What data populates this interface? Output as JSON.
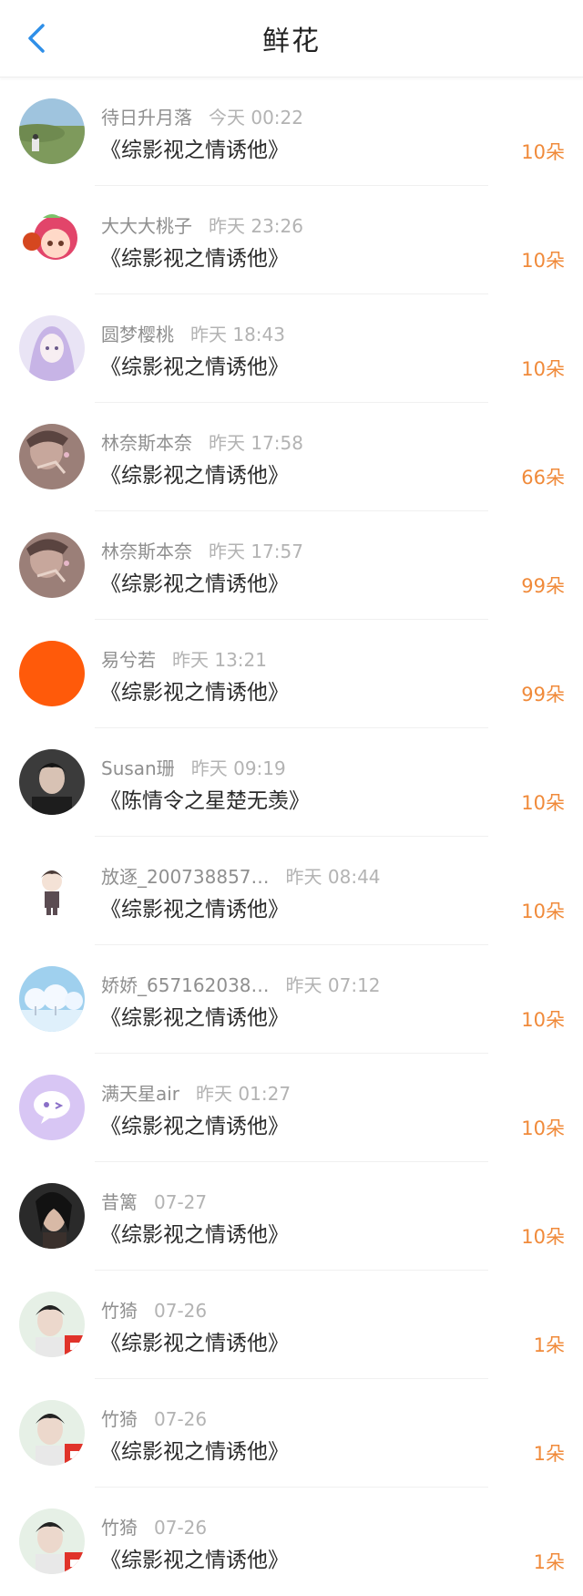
{
  "header": {
    "title": "鲜花"
  },
  "items": [
    {
      "name": "待日升月落",
      "time": "今天 00:22",
      "book": "《综影视之情诱他》",
      "count": "10朵",
      "avatar_icon": "landscape-avatar-icon"
    },
    {
      "name": "大大大桃子",
      "time": "昨天 23:26",
      "book": "《综影视之情诱他》",
      "count": "10朵",
      "avatar_icon": "peach-character-avatar-icon"
    },
    {
      "name": "圆梦樱桃",
      "time": "昨天 18:43",
      "book": "《综影视之情诱他》",
      "count": "10朵",
      "avatar_icon": "anime-girl-avatar-icon"
    },
    {
      "name": "林奈斯本奈",
      "time": "昨天 17:58",
      "book": "《综影视之情诱他》",
      "count": "66朵",
      "avatar_icon": "person-photo-avatar-icon"
    },
    {
      "name": "林奈斯本奈",
      "time": "昨天 17:57",
      "book": "《综影视之情诱他》",
      "count": "99朵",
      "avatar_icon": "person-photo-avatar-icon"
    },
    {
      "name": "易兮若",
      "time": "昨天 13:21",
      "book": "《综影视之情诱他》",
      "count": "99朵",
      "avatar_icon": "orange-circle-avatar-icon"
    },
    {
      "name": "Susan珊",
      "time": "昨天 09:19",
      "book": "《陈情令之星楚无羡》",
      "count": "10朵",
      "avatar_icon": "man-portrait-avatar-icon"
    },
    {
      "name": "放逐_200738857…",
      "time": "昨天 08:44",
      "book": "《综影视之情诱他》",
      "count": "10朵",
      "avatar_icon": "cartoon-boy-avatar-icon"
    },
    {
      "name": "娇娇_657162038…",
      "time": "昨天 07:12",
      "book": "《综影视之情诱他》",
      "count": "10朵",
      "avatar_icon": "winter-trees-avatar-icon"
    },
    {
      "name": "满天星air",
      "time": "昨天 01:27",
      "book": "《综影视之情诱他》",
      "count": "10朵",
      "avatar_icon": "chat-bubble-avatar-icon"
    },
    {
      "name": "昔篱",
      "time": "07-27",
      "book": "《综影视之情诱他》",
      "count": "10朵",
      "avatar_icon": "woman-portrait-avatar-icon"
    },
    {
      "name": "竹猗",
      "time": "07-26",
      "book": "《综影视之情诱他》",
      "count": "1朵",
      "avatar_icon": "man-red-avatar-icon"
    },
    {
      "name": "竹猗",
      "time": "07-26",
      "book": "《综影视之情诱他》",
      "count": "1朵",
      "avatar_icon": "man-red-avatar-icon"
    },
    {
      "name": "竹猗",
      "time": "07-26",
      "book": "《综影视之情诱他》",
      "count": "1朵",
      "avatar_icon": "man-red-avatar-icon"
    }
  ],
  "colors": {
    "accent": "#2f8fe8",
    "count": "#f08a3a"
  }
}
